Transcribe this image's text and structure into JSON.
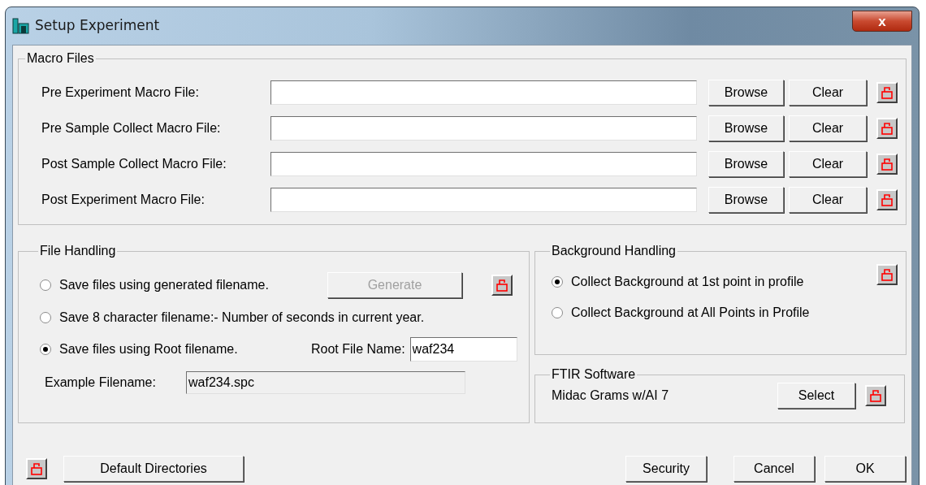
{
  "window": {
    "title": "Setup Experiment",
    "close": "x"
  },
  "macro_files": {
    "title": "Macro Files",
    "rows": [
      {
        "label": "Pre Experiment Macro File:",
        "browse": "Browse",
        "clear": "Clear"
      },
      {
        "label": "Pre Sample Collect Macro File:",
        "browse": "Browse",
        "clear": "Clear"
      },
      {
        "label": "Post Sample Collect Macro File:",
        "browse": "Browse",
        "clear": "Clear"
      },
      {
        "label": "Post Experiment Macro File:",
        "browse": "Browse",
        "clear": "Clear"
      }
    ]
  },
  "file_handling": {
    "title": "File Handling",
    "options": [
      {
        "label": "Save files using generated filename.",
        "selected": false
      },
      {
        "label": "Save 8 character filename:-  Number of seconds in current year.",
        "selected": false
      },
      {
        "label": "Save files using Root filename.",
        "selected": true
      }
    ],
    "generate": {
      "label": "Generate",
      "disabled": true
    },
    "root_label": "Root File Name:",
    "root_value": "waf234",
    "example_label": "Example Filename:",
    "example_value": "waf234.spc"
  },
  "background_handling": {
    "title": "Background Handling",
    "options": [
      {
        "label": "Collect Background at 1st point in profile",
        "selected": true
      },
      {
        "label": "Collect Background at All Points in Profile",
        "selected": false
      }
    ]
  },
  "ftir_software": {
    "title": "FTIR Software",
    "value": "Midac Grams w/AI 7",
    "select": "Select"
  },
  "buttons": {
    "default_directories": "Default Directories",
    "security": "Security",
    "cancel": "Cancel",
    "ok": "OK"
  }
}
